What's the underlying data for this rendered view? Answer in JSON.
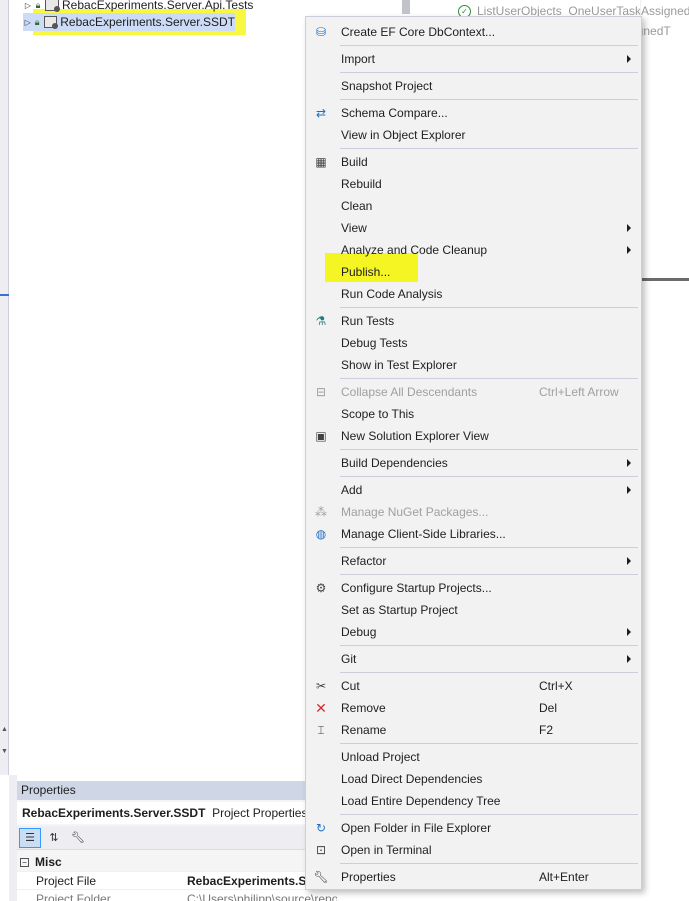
{
  "tree": {
    "items": [
      {
        "label": "RebacExperiments.Server.Api.Tests"
      },
      {
        "label": "RebacExperiments.Server.SSDT"
      }
    ]
  },
  "test_panel": {
    "items": [
      {
        "label": "ListUserObjects_OneUserTaskAssignedT"
      },
      {
        "label": "signedT"
      }
    ]
  },
  "properties": {
    "title": "Properties",
    "object_name": "RebacExperiments.Server.SSDT",
    "object_type": "Project Properties",
    "category": "Misc",
    "rows": [
      {
        "key": "Project File",
        "value": "RebacExperiments.Se"
      },
      {
        "key": "Project Folder",
        "value": "C:\\Users\\philipp\\source\\repos\\bytefish\\"
      }
    ]
  },
  "context_menu": {
    "items": [
      {
        "label": "Create EF Core DbContext...",
        "shortcut": "",
        "icon": "ef-core-icon"
      },
      {
        "label": "Import",
        "shortcut": "",
        "icon": ""
      },
      {
        "label": "Snapshot Project",
        "shortcut": "",
        "icon": ""
      },
      {
        "label": "Schema Compare...",
        "shortcut": "",
        "icon": "schema-compare-icon"
      },
      {
        "label": "View in Object Explorer",
        "shortcut": "",
        "icon": ""
      },
      {
        "label": "Build",
        "shortcut": "",
        "icon": "build-icon"
      },
      {
        "label": "Rebuild",
        "shortcut": "",
        "icon": ""
      },
      {
        "label": "Clean",
        "shortcut": "",
        "icon": ""
      },
      {
        "label": "View",
        "shortcut": "",
        "icon": ""
      },
      {
        "label": "Analyze and Code Cleanup",
        "shortcut": "",
        "icon": ""
      },
      {
        "label": "Publish...",
        "shortcut": "",
        "icon": ""
      },
      {
        "label": "Run Code Analysis",
        "shortcut": "",
        "icon": ""
      },
      {
        "label": "Run Tests",
        "shortcut": "",
        "icon": "run-tests-icon"
      },
      {
        "label": "Debug Tests",
        "shortcut": "",
        "icon": ""
      },
      {
        "label": "Show in Test Explorer",
        "shortcut": "",
        "icon": ""
      },
      {
        "label": "Collapse All Descendants",
        "shortcut": "Ctrl+Left Arrow",
        "icon": "collapse-icon"
      },
      {
        "label": "Scope to This",
        "shortcut": "",
        "icon": ""
      },
      {
        "label": "New Solution Explorer View",
        "shortcut": "",
        "icon": "new-view-icon"
      },
      {
        "label": "Build Dependencies",
        "shortcut": "",
        "icon": ""
      },
      {
        "label": "Add",
        "shortcut": "",
        "icon": ""
      },
      {
        "label": "Manage NuGet Packages...",
        "shortcut": "",
        "icon": "nuget-icon"
      },
      {
        "label": "Manage Client-Side Libraries...",
        "shortcut": "",
        "icon": "globe-icon"
      },
      {
        "label": "Refactor",
        "shortcut": "",
        "icon": ""
      },
      {
        "label": "Configure Startup Projects...",
        "shortcut": "",
        "icon": "gear-icon"
      },
      {
        "label": "Set as Startup Project",
        "shortcut": "",
        "icon": ""
      },
      {
        "label": "Debug",
        "shortcut": "",
        "icon": ""
      },
      {
        "label": "Git",
        "shortcut": "",
        "icon": ""
      },
      {
        "label": "Cut",
        "shortcut": "Ctrl+X",
        "icon": "scissors-icon"
      },
      {
        "label": "Remove",
        "shortcut": "Del",
        "icon": "close-icon"
      },
      {
        "label": "Rename",
        "shortcut": "F2",
        "icon": "rename-icon"
      },
      {
        "label": "Unload Project",
        "shortcut": "",
        "icon": ""
      },
      {
        "label": "Load Direct Dependencies",
        "shortcut": "",
        "icon": ""
      },
      {
        "label": "Load Entire Dependency Tree",
        "shortcut": "",
        "icon": ""
      },
      {
        "label": "Open Folder in File Explorer",
        "shortcut": "",
        "icon": "refresh-folder-icon"
      },
      {
        "label": "Open in Terminal",
        "shortcut": "",
        "icon": "terminal-icon"
      },
      {
        "label": "Properties",
        "shortcut": "Alt+Enter",
        "icon": "wrench-icon"
      }
    ]
  },
  "colors": {
    "highlight": "#f6f600",
    "selection": "#ccdbf6",
    "menu_bg": "#f2f2f2",
    "properties_header": "#cfd6e5"
  }
}
